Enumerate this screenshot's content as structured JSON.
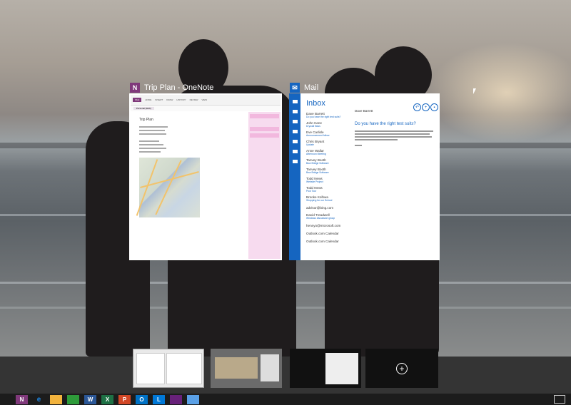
{
  "windows": [
    {
      "title": "Trip Plan - OneNote",
      "icon": "onenote-icon",
      "content": {
        "ribbon_file": "FILE",
        "ribbon_tabs": [
          "HOME",
          "INSERT",
          "DRAW",
          "HISTORY",
          "REVIEW",
          "VIEW"
        ],
        "notebook": "Personal (Web)",
        "page_title": "Trip Plan"
      }
    },
    {
      "title": "Mail",
      "icon": "mail-icon",
      "content": {
        "folder": "Inbox",
        "messages": [
          {
            "from": "Dave Barrett",
            "preview": "Do you have the right test suits?"
          },
          {
            "from": "John Kane",
            "preview": "Drywall flaws"
          },
          {
            "from": "Eve Carlisle",
            "preview": "Announcement follow"
          },
          {
            "from": "Chris Bryant",
            "preview": "Update"
          },
          {
            "from": "Anne Wallar",
            "preview": "Afternoon Meeting"
          },
          {
            "from": "Tanvey Booth",
            "preview": "Bow Bridge Software"
          },
          {
            "from": "Tanvey Booth",
            "preview": "Bow Bridge Software"
          },
          {
            "from": "Todd News",
            "preview": "Website Project"
          },
          {
            "from": "Todd News",
            "preview": "Pool Tour"
          },
          {
            "from": "Brooke Kolhwa",
            "preview": "Shopping for our School"
          },
          {
            "from": "advisor@bing.com",
            "preview": ""
          },
          {
            "from": "David Treadwell",
            "preview": "Windows discussion group"
          },
          {
            "from": "hennyo@microsoft.com",
            "preview": ""
          },
          {
            "from": "Outlook.com Calendar",
            "preview": ""
          },
          {
            "from": "Outlook.com Calendar",
            "preview": ""
          }
        ],
        "reading_from": "Dave Barrett",
        "reading_subject": "Do you have the right test suits?"
      }
    }
  ],
  "desktops": {
    "add_symbol": "+"
  },
  "taskbar": {
    "apps": [
      {
        "name": "onenote",
        "glyph": "N",
        "color": "#80397b"
      },
      {
        "name": "ie",
        "glyph": "e",
        "color": "#1e88e5"
      },
      {
        "name": "explorer",
        "glyph": "",
        "color": "#f2b33d"
      },
      {
        "name": "store",
        "glyph": "",
        "color": "#2e9b3a"
      },
      {
        "name": "word",
        "glyph": "W",
        "color": "#2b5797"
      },
      {
        "name": "excel",
        "glyph": "X",
        "color": "#1e7145"
      },
      {
        "name": "powerpoint",
        "glyph": "P",
        "color": "#d24726"
      },
      {
        "name": "outlook",
        "glyph": "O",
        "color": "#0072c6"
      },
      {
        "name": "lync",
        "glyph": "L",
        "color": "#0078d7"
      },
      {
        "name": "visual-studio",
        "glyph": "",
        "color": "#68217a"
      },
      {
        "name": "notepad",
        "glyph": "",
        "color": "#5aa0e6"
      }
    ]
  }
}
